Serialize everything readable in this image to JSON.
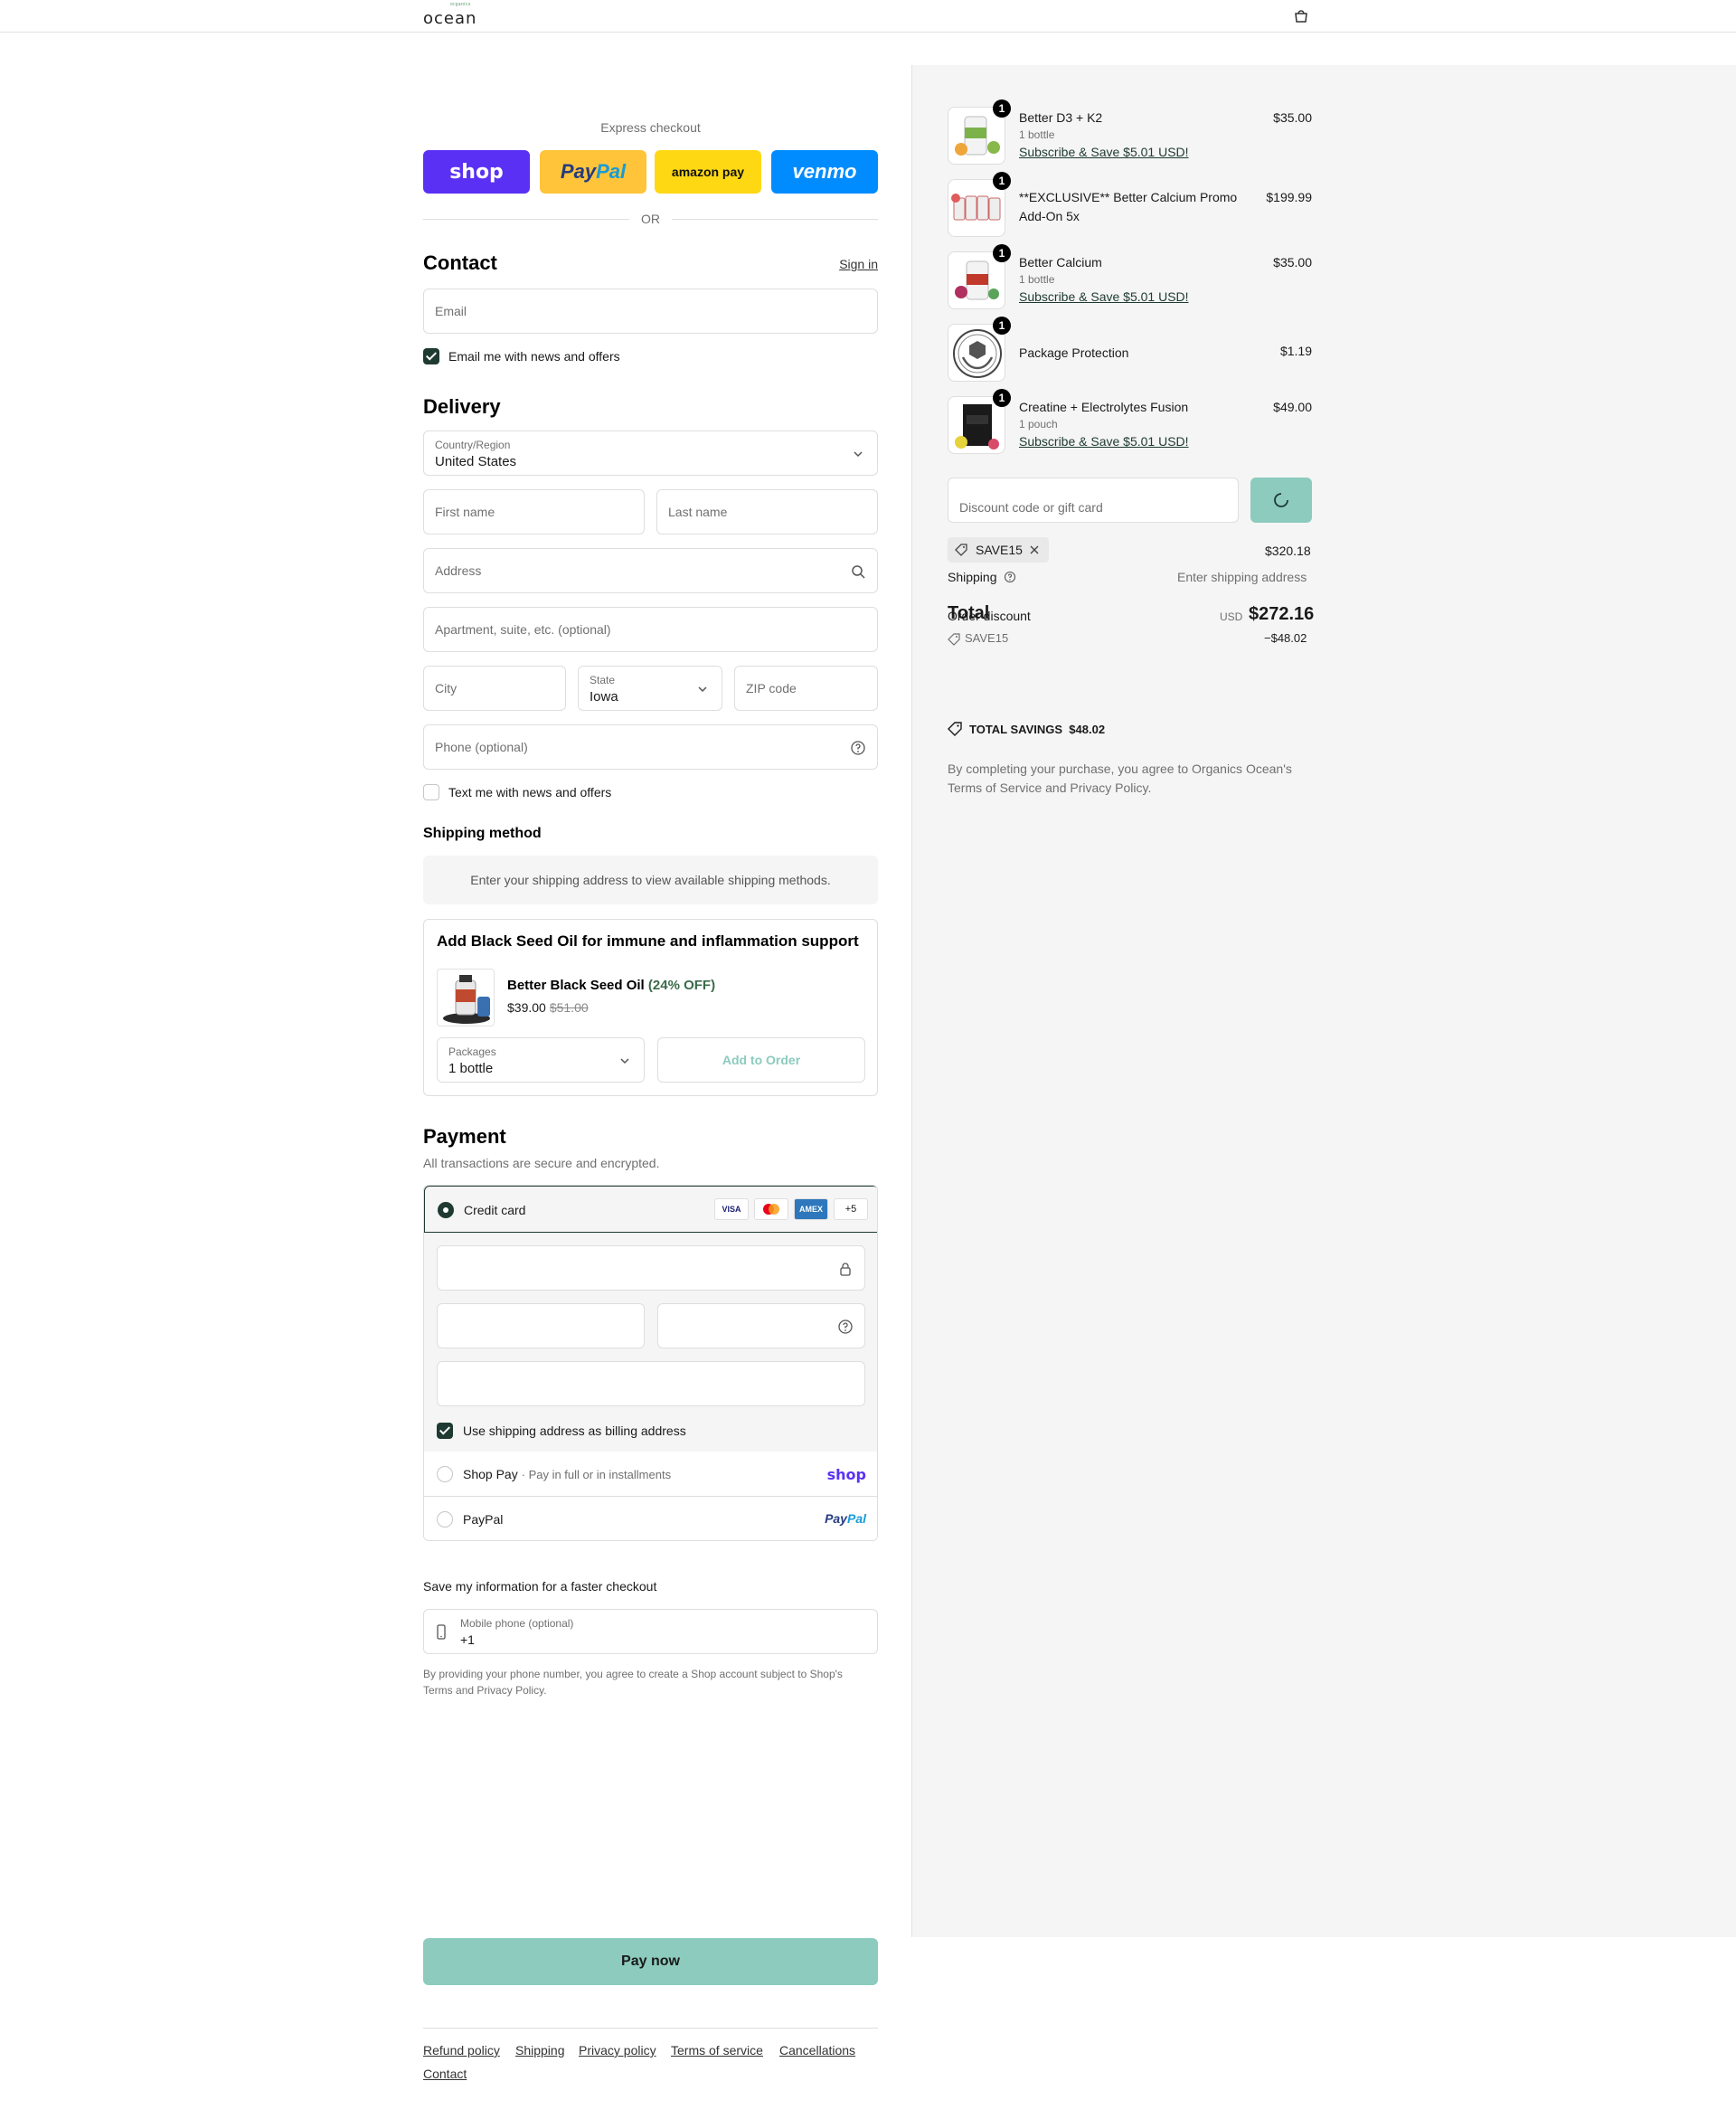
{
  "header": {
    "logo_text": "ocean",
    "logo_top": "organics",
    "cart_icon": "bag-icon"
  },
  "express": {
    "label": "Express checkout",
    "shop": "shop",
    "paypal_a": "Pay",
    "paypal_b": "Pal",
    "amazon": "amazon pay",
    "venmo": "venmo",
    "or": "OR"
  },
  "contact": {
    "title": "Contact",
    "sign_in": "Sign in",
    "email_placeholder": "Email",
    "email_news_label": "Email me with news and offers"
  },
  "delivery": {
    "title": "Delivery",
    "country_label": "Country/Region",
    "country_value": "United States",
    "first_name": "First name",
    "last_name": "Last name",
    "address": "Address",
    "apartment": "Apartment, suite, etc. (optional)",
    "city": "City",
    "state_label": "State",
    "state_value": "Iowa",
    "zip": "ZIP code",
    "phone": "Phone (optional)",
    "text_news_label": "Text me with news and offers"
  },
  "shipping_method": {
    "title": "Shipping method",
    "message": "Enter your shipping address to view available shipping methods."
  },
  "upsell": {
    "title": "Add Black Seed Oil for immune and inflammation support",
    "product_name": "Better Black Seed Oil",
    "discount": "(24% OFF)",
    "price": "$39.00",
    "old_price": "$51.00",
    "packages_label": "Packages",
    "packages_value": "1 bottle",
    "add_button": "Add to Order"
  },
  "payment": {
    "title": "Payment",
    "subtitle": "All transactions are secure and encrypted.",
    "credit_card": "Credit card",
    "card_more": "+5",
    "visa": "VISA",
    "amex": "AMEX",
    "billing_label": "Use shipping address as billing address",
    "shop_pay": "Shop Pay",
    "shop_pay_desc": "Pay in full or in installments",
    "shop_word": "shop",
    "paypal": "PayPal",
    "paypal_a": "Pay",
    "paypal_b": "Pal"
  },
  "save_info": {
    "title": "Save my information for a faster checkout",
    "mobile_label": "Mobile phone (optional)",
    "mobile_value": "+1",
    "note_a": "By providing your phone number, you agree to create a Shop account subject to Shop's",
    "terms": "Terms",
    "and": "and",
    "privacy": "Privacy Policy"
  },
  "pay_now": "Pay now",
  "footer": {
    "links": [
      "Refund policy",
      "Shipping",
      "Privacy policy",
      "Terms of service",
      "Cancellations",
      "Contact"
    ]
  },
  "summary": {
    "items": [
      {
        "name": "Better D3 + K2",
        "variant": "1 bottle",
        "subscribe": "Subscribe & Save $5.01 USD!",
        "price": "$35.00",
        "qty": "1"
      },
      {
        "name": "**EXCLUSIVE** Better Calcium Promo Add-On 5x",
        "variant": "",
        "subscribe": "",
        "price": "$199.99",
        "qty": "1"
      },
      {
        "name": "Better Calcium",
        "variant": "1 bottle",
        "subscribe": "Subscribe & Save $5.01 USD!",
        "price": "$35.00",
        "qty": "1"
      },
      {
        "name": "Package Protection",
        "variant": "",
        "subscribe": "",
        "price": "$1.19",
        "qty": "1"
      },
      {
        "name": "Creatine + Electrolytes Fusion",
        "variant": "1 pouch",
        "subscribe": "Subscribe & Save $5.01 USD!",
        "price": "$49.00",
        "qty": "1"
      }
    ],
    "discount_placeholder": "Discount code or gift card",
    "applied_code": "SAVE15",
    "subtotal": "$320.18",
    "shipping_label": "Shipping",
    "shipping_value": "Enter shipping address",
    "order_discount_label": "Order discount",
    "total_label": "Total",
    "currency": "USD",
    "total_value": "$272.16",
    "discount_code": "SAVE15",
    "discount_value": "−$48.02",
    "total_savings_label": "TOTAL SAVINGS",
    "total_savings_value": "$48.02",
    "legal_a": "By completing your purchase, you agree to Organics Ocean's",
    "terms": "Terms of Service",
    "and": "and",
    "privacy": "Privacy Policy",
    "period": "."
  },
  "colors": {
    "accent_dark": "#1e3a32",
    "pay_button": "#8ccbbd",
    "shop_purple": "#5a31f4",
    "paypal_yellow": "#ffc439",
    "amazon_yellow": "#ffd814",
    "venmo_blue": "#008cff"
  }
}
